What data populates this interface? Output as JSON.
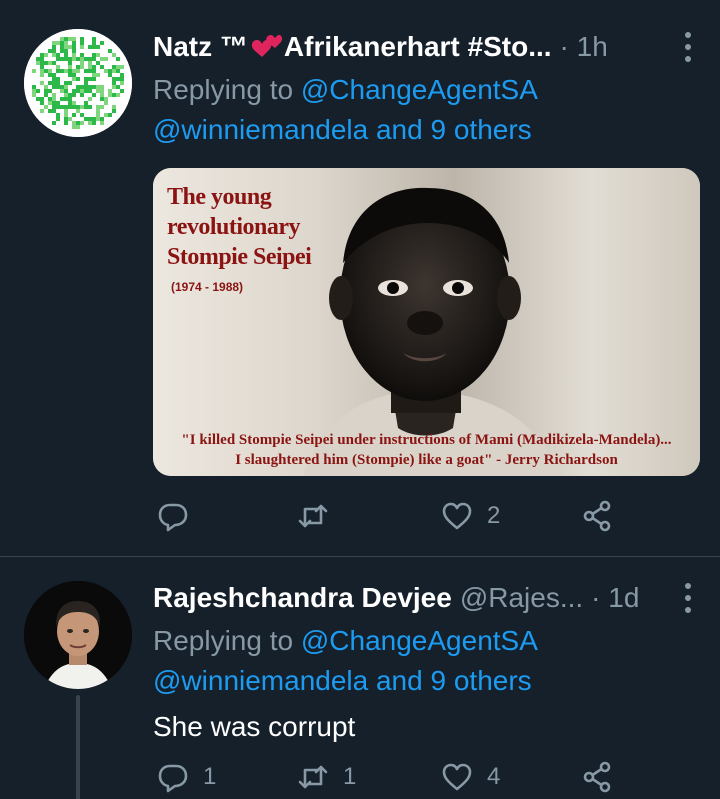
{
  "tweets": [
    {
      "display_name": "Natz ™",
      "display_name_suffix": "Afrikanerhart #Sto...",
      "handle": "",
      "time": "· 1h",
      "replying_prefix": "Replying to",
      "replying_to": "@ChangeAgentSA",
      "replying_others": "@winniemandela and 9 others",
      "text": "",
      "media": {
        "title_lines": [
          "The young",
          "revolutionary",
          "Stompie Seipei"
        ],
        "dates": "(1974 - 1988)",
        "quote_line1": "\"I killed Stompie Seipei under instructions of Mami (Madikizela-Mandela)...",
        "quote_line2": "I slaughtered him (Stompie) like a goat\"  - Jerry Richardson"
      },
      "actions": {
        "reply_count": "",
        "retweet_count": "",
        "like_count": "2"
      }
    },
    {
      "display_name": "Rajeshchandra Devjee",
      "handle": "@Rajes...",
      "time": "· 1d",
      "replying_prefix": "Replying to",
      "replying_to": "@ChangeAgentSA",
      "replying_others": "@winniemandela and 9 others",
      "text": "She was corrupt",
      "actions": {
        "reply_count": "1",
        "retweet_count": "1",
        "like_count": "4"
      }
    }
  ],
  "colors": {
    "background": "#15202b",
    "accent": "#1d9bf0",
    "secondary_text": "#8899a6",
    "media_text": "#8b1412"
  },
  "icons": [
    "qr-code-avatar-icon",
    "heart-emoji-icon",
    "more-icon",
    "reply-icon",
    "retweet-icon",
    "like-icon",
    "share-icon"
  ]
}
